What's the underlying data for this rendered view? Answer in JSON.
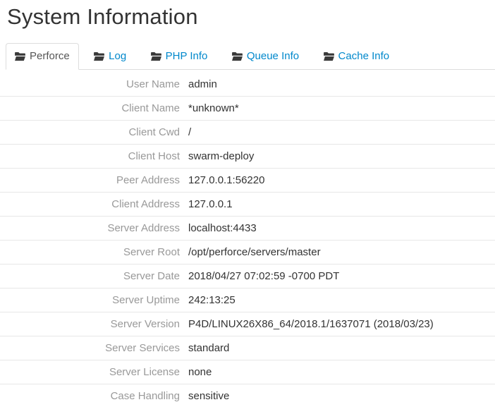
{
  "page": {
    "title": "System Information"
  },
  "tabs": [
    {
      "label": "Perforce",
      "icon": "folder-icon",
      "active": true
    },
    {
      "label": "Log",
      "icon": "folder-icon",
      "active": false
    },
    {
      "label": "PHP Info",
      "icon": "folder-icon",
      "active": false
    },
    {
      "label": "Queue Info",
      "icon": "folder-icon",
      "active": false
    },
    {
      "label": "Cache Info",
      "icon": "folder-icon",
      "active": false
    }
  ],
  "rows": [
    {
      "label": "User Name",
      "value": "admin"
    },
    {
      "label": "Client Name",
      "value": "*unknown*"
    },
    {
      "label": "Client Cwd",
      "value": "/"
    },
    {
      "label": "Client Host",
      "value": "swarm-deploy"
    },
    {
      "label": "Peer Address",
      "value": "127.0.0.1:56220"
    },
    {
      "label": "Client Address",
      "value": "127.0.0.1"
    },
    {
      "label": "Server Address",
      "value": "localhost:4433"
    },
    {
      "label": "Server Root",
      "value": "/opt/perforce/servers/master"
    },
    {
      "label": "Server Date",
      "value": "2018/04/27 07:02:59 -0700 PDT"
    },
    {
      "label": "Server Uptime",
      "value": "242:13:25"
    },
    {
      "label": "Server Version",
      "value": "P4D/LINUX26X86_64/2018.1/1637071 (2018/03/23)"
    },
    {
      "label": "Server Services",
      "value": "standard"
    },
    {
      "label": "Server License",
      "value": "none"
    },
    {
      "label": "Case Handling",
      "value": "sensitive"
    }
  ],
  "colors": {
    "link_blue": "#0088cc",
    "label_gray": "#999999",
    "value_dark": "#333333",
    "border_light": "#e7e7e7",
    "tab_border": "#dddddd",
    "icon_dark": "#3a3a3a",
    "title_dark": "#333333"
  }
}
